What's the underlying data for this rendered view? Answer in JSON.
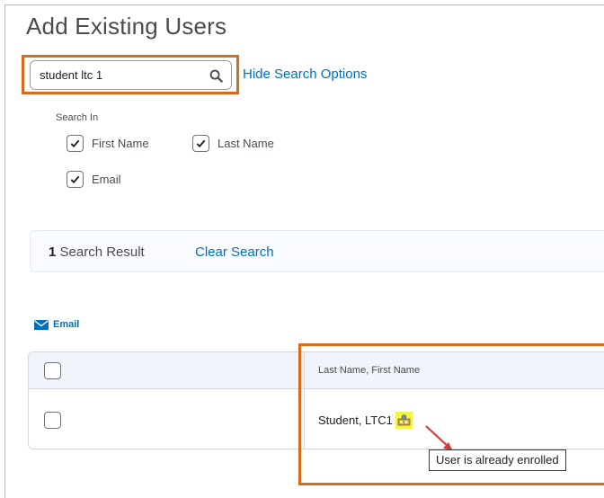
{
  "page": {
    "title": "Add Existing Users"
  },
  "search": {
    "value": "student ltc 1",
    "toggle_options_label": "Hide Search Options"
  },
  "search_in": {
    "label": "Search In",
    "options": [
      {
        "label": "First Name",
        "checked": true
      },
      {
        "label": "Last Name",
        "checked": true
      },
      {
        "label": "Email",
        "checked": true
      }
    ]
  },
  "results": {
    "count": "1",
    "count_label": "Search Result",
    "clear_label": "Clear Search"
  },
  "actions": {
    "email_label": "Email"
  },
  "table": {
    "columns": [
      "",
      "Last Name, First Name"
    ],
    "rows": [
      {
        "name": "Student, LTC1",
        "status_icon": "enrolled-icon"
      }
    ]
  },
  "tooltip": {
    "text": "User is already enrolled"
  },
  "colors": {
    "link": "#006fbf",
    "highlight": "#d96b1d",
    "icon_highlight": "#f3f34a",
    "arrow": "#d33b3b"
  },
  "icons": {
    "search": "search-icon",
    "email": "envelope-icon",
    "check": "checkmark-icon",
    "enrolled": "enrolled-user-icon"
  }
}
